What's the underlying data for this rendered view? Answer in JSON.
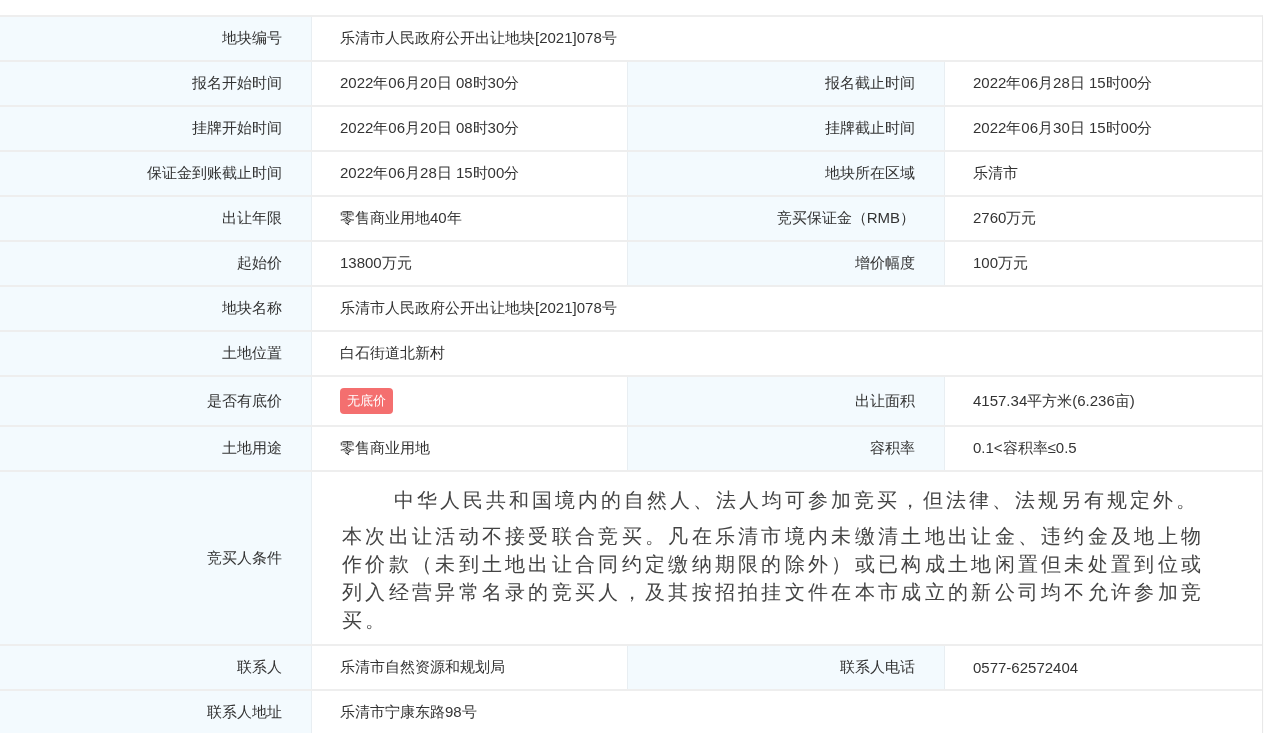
{
  "rows": [
    {
      "cells": [
        {
          "label": "地块编号",
          "kind": "text",
          "value": "乐清市人民政府公开出让地块[2021]078号"
        }
      ]
    },
    {
      "cells": [
        {
          "label": "报名开始时间",
          "kind": "text",
          "value": "2022年06月20日 08时30分"
        },
        {
          "label": "报名截止时间",
          "kind": "text",
          "value": "2022年06月28日 15时00分"
        }
      ]
    },
    {
      "cells": [
        {
          "label": "挂牌开始时间",
          "kind": "text",
          "value": "2022年06月20日 08时30分"
        },
        {
          "label": "挂牌截止时间",
          "kind": "text",
          "value": "2022年06月30日 15时00分"
        }
      ]
    },
    {
      "cells": [
        {
          "label": "保证金到账截止时间",
          "kind": "text",
          "value": "2022年06月28日 15时00分"
        },
        {
          "label": "地块所在区域",
          "kind": "text",
          "value": "乐清市"
        }
      ]
    },
    {
      "cells": [
        {
          "label": "出让年限",
          "kind": "text",
          "value": "零售商业用地40年"
        },
        {
          "label": "竞买保证金（RMB）",
          "kind": "text",
          "value": "2760万元"
        }
      ]
    },
    {
      "cells": [
        {
          "label": "起始价",
          "kind": "text",
          "value": "13800万元"
        },
        {
          "label": "增价幅度",
          "kind": "text",
          "value": "100万元"
        }
      ]
    },
    {
      "cells": [
        {
          "label": "地块名称",
          "kind": "text",
          "value": "乐清市人民政府公开出让地块[2021]078号"
        }
      ]
    },
    {
      "cells": [
        {
          "label": "土地位置",
          "kind": "text",
          "value": "白石街道北新村"
        }
      ]
    },
    {
      "cells": [
        {
          "label": "是否有底价",
          "kind": "badge",
          "value": "无底价"
        },
        {
          "label": "出让面积",
          "kind": "text",
          "value": "4157.34平方米(6.236亩)"
        }
      ]
    },
    {
      "cells": [
        {
          "label": "土地用途",
          "kind": "text",
          "value": "零售商业用地"
        },
        {
          "label": "容积率",
          "kind": "text",
          "value": "0.1<容积率≤0.5"
        }
      ]
    },
    {
      "cells": [
        {
          "label": "竞买人条件",
          "kind": "paragraphs",
          "paragraphs": [
            {
              "indent": true,
              "text": "中华人民共和国境内的自然人、法人均可参加竞买，但法律、法规另有规定外。"
            },
            {
              "indent": false,
              "text": "本次出让活动不接受联合竞买。凡在乐清市境内未缴清土地出让金、违约金及地上物作价款（未到土地出让合同约定缴纳期限的除外）或已构成土地闲置但未处置到位或列入经营异常名录的竞买人，及其按招拍挂文件在本市成立的新公司均不允许参加竞买。"
            }
          ]
        }
      ]
    },
    {
      "cells": [
        {
          "label": "联系人",
          "kind": "text",
          "value": "乐清市自然资源和规划局"
        },
        {
          "label": "联系人电话",
          "kind": "text",
          "value": "0577-62572404"
        }
      ]
    },
    {
      "cells": [
        {
          "label": "联系人地址",
          "kind": "text",
          "value": "乐清市宁康东路98号"
        }
      ]
    }
  ]
}
